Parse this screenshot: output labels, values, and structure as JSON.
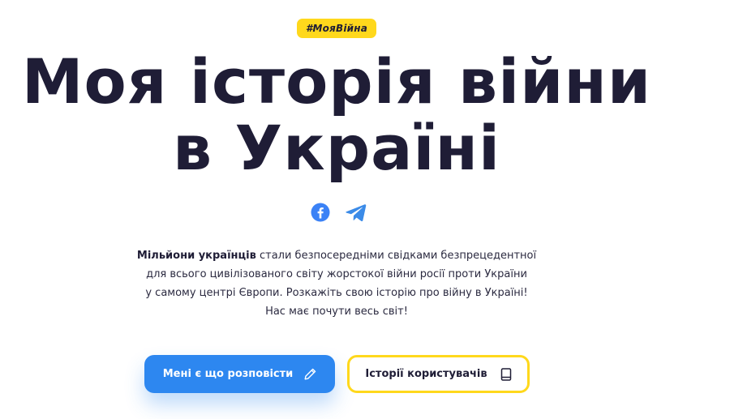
{
  "hero": {
    "hashtag": "#МояВійна",
    "title_line1": "Моя історія війни",
    "title_line2": "в Україні"
  },
  "social": {
    "links": [
      {
        "icon": "facebook-icon",
        "color": "#3b82f6"
      },
      {
        "icon": "telegram-icon",
        "color": "#3b8be8"
      }
    ]
  },
  "intro": {
    "bold_lead": "Мільйони українців",
    "text_1": " стали безпосередніми свідками безпрецедентної",
    "text_2": "для всього цивілізованого світу жорстокої війни росії проти України",
    "text_3": "у самому центрі Європи. Розкажіть свою історію про війну в Україні!",
    "text_4": "Нас має почути весь світ!"
  },
  "actions": {
    "primary_label": "Мені є що розповісти",
    "primary_icon": "pencil-icon",
    "secondary_label": "Історії користувачів",
    "secondary_icon": "book-icon"
  },
  "colors": {
    "accent_yellow": "#ffd81c",
    "accent_blue": "#2d87f0",
    "text_dark": "#1f1d36"
  }
}
